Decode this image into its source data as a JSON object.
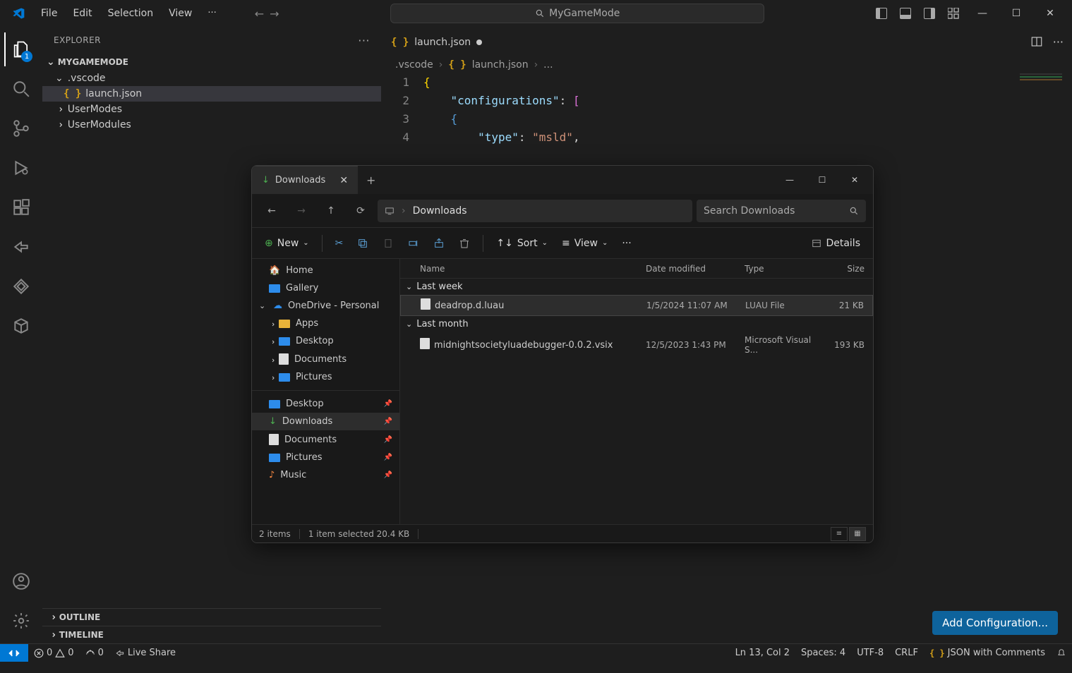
{
  "titlebar": {
    "menu": [
      "File",
      "Edit",
      "Selection",
      "View"
    ],
    "search_label": "MyGameMode"
  },
  "activity": {
    "badge": "1"
  },
  "sidebar": {
    "title": "EXPLORER",
    "workspace": "MYGAMEMODE",
    "items": [
      {
        "label": ".vscode",
        "expanded": true
      },
      {
        "label": "launch.json",
        "nested": true,
        "selected": true,
        "icon": "json"
      },
      {
        "label": "UserModes"
      },
      {
        "label": "UserModules"
      }
    ],
    "outline": "OUTLINE",
    "timeline": "TIMELINE"
  },
  "editor": {
    "tab_label": "launch.json",
    "breadcrumbs": [
      ".vscode",
      "launch.json",
      "..."
    ],
    "code_lines": [
      {
        "num": "1",
        "indent": 0,
        "tokens": [
          {
            "t": "{",
            "c": "gold"
          }
        ]
      },
      {
        "num": "2",
        "indent": 1,
        "tokens": [
          {
            "t": "\"configurations\"",
            "c": "tok-key"
          },
          {
            "t": ":",
            "c": "tok-punct"
          },
          {
            "t": " ",
            "c": ""
          },
          {
            "t": "[",
            "c": "pink"
          }
        ]
      },
      {
        "num": "3",
        "indent": 1,
        "tokens": [
          {
            "t": "{",
            "c": "blue"
          }
        ]
      },
      {
        "num": "4",
        "indent": 2,
        "tokens": [
          {
            "t": "\"type\"",
            "c": "tok-key"
          },
          {
            "t": ":",
            "c": "tok-punct"
          },
          {
            "t": " ",
            "c": ""
          },
          {
            "t": "\"msld\"",
            "c": "tok-str"
          },
          {
            "t": ",",
            "c": "tok-punct"
          }
        ]
      }
    ],
    "add_config": "Add Configuration..."
  },
  "statusbar": {
    "errors": "0",
    "warnings": "0",
    "ports": "0",
    "liveshare": "Live Share",
    "ln_col": "Ln 13, Col 2",
    "spaces": "Spaces: 4",
    "encoding": "UTF-8",
    "eol": "CRLF",
    "lang": "JSON with Comments"
  },
  "explorer": {
    "tab": "Downloads",
    "address": "Downloads",
    "search_placeholder": "Search Downloads",
    "ribbon": {
      "new": "New",
      "sort": "Sort",
      "view": "View",
      "details": "Details"
    },
    "nav": [
      {
        "label": "Home",
        "icon": "home"
      },
      {
        "label": "Gallery",
        "icon": "pic"
      },
      {
        "label": "OneDrive - Personal",
        "icon": "cloud",
        "chevron": true
      },
      {
        "label": "Apps",
        "icon": "folder",
        "sub": true
      },
      {
        "label": "Desktop",
        "icon": "pic",
        "sub": true
      },
      {
        "label": "Documents",
        "icon": "doc",
        "sub": true
      },
      {
        "label": "Pictures",
        "icon": "pic",
        "sub": true
      }
    ],
    "nav2": [
      {
        "label": "Desktop",
        "icon": "pic",
        "pin": true
      },
      {
        "label": "Downloads",
        "icon": "download",
        "pin": true,
        "selected": true
      },
      {
        "label": "Documents",
        "icon": "doc",
        "pin": true
      },
      {
        "label": "Pictures",
        "icon": "pic",
        "pin": true
      },
      {
        "label": "Music",
        "icon": "music",
        "pin": true
      }
    ],
    "columns": [
      "Name",
      "Date modified",
      "Type",
      "Size"
    ],
    "groups": [
      {
        "title": "Last week",
        "rows": [
          {
            "name": "deadrop.d.luau",
            "date": "1/5/2024 11:07 AM",
            "type": "LUAU File",
            "size": "21 KB",
            "selected": true
          }
        ]
      },
      {
        "title": "Last month",
        "rows": [
          {
            "name": "midnightsocietyluadebugger-0.0.2.vsix",
            "date": "12/5/2023 1:43 PM",
            "type": "Microsoft Visual S...",
            "size": "193 KB"
          }
        ]
      }
    ],
    "status": {
      "count": "2 items",
      "selected": "1 item selected  20.4 KB"
    }
  }
}
